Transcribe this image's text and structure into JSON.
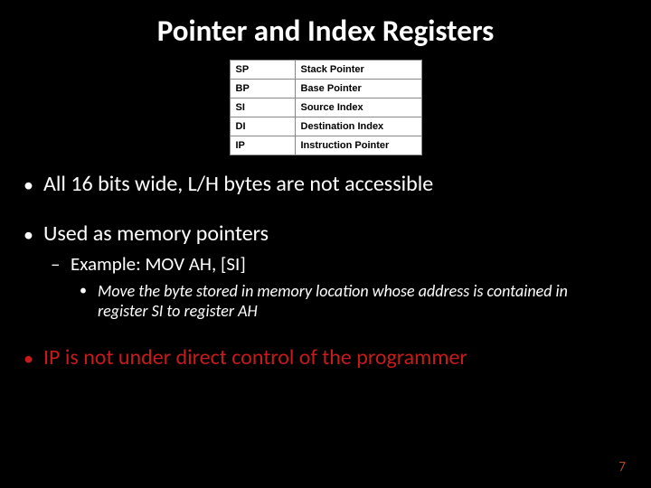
{
  "title": "Pointer and Index Registers",
  "registers": [
    {
      "abbr": "SP",
      "desc": "Stack Pointer"
    },
    {
      "abbr": "BP",
      "desc": "Base Pointer"
    },
    {
      "abbr": "SI",
      "desc": "Source Index"
    },
    {
      "abbr": "DI",
      "desc": "Destination Index"
    },
    {
      "abbr": "IP",
      "desc": "Instruction Pointer"
    }
  ],
  "bullets": {
    "b1": "All 16 bits wide, L/H bytes are not accessible",
    "b2": "Used as memory pointers",
    "b2_sub": "Example: MOV AH, [SI]",
    "b2_sub_sub": "Move the byte stored in memory location whose address is contained in register SI to register AH",
    "b3": "IP is not under direct control of the programmer"
  },
  "page_number": "7"
}
